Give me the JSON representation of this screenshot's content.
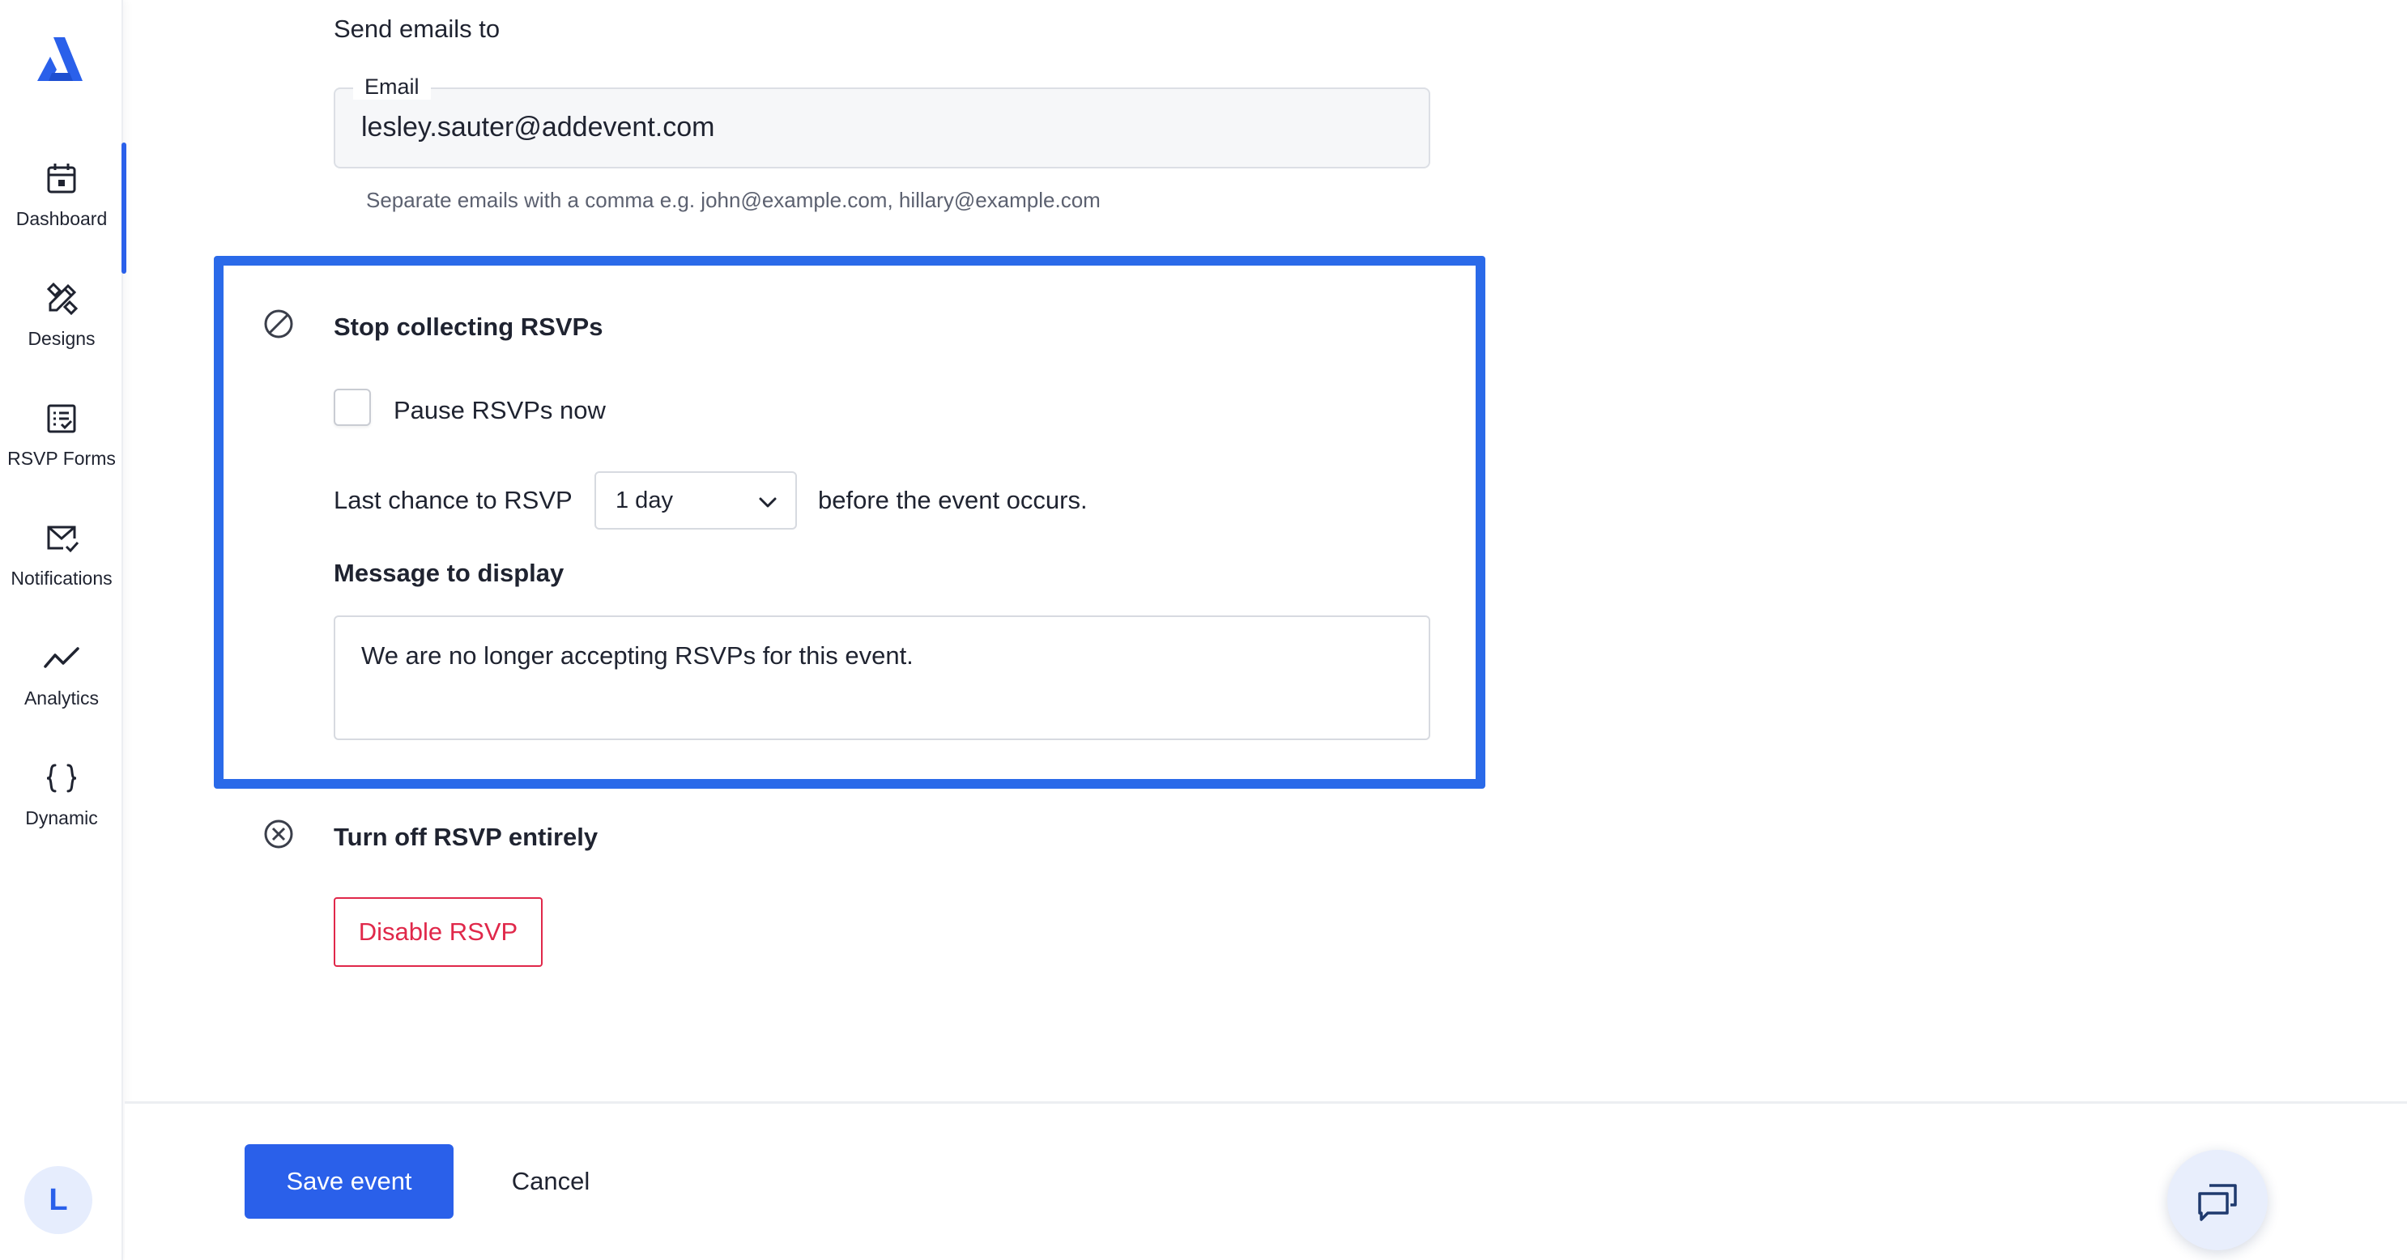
{
  "sidebar": {
    "logo": "addevent-logo",
    "items": [
      {
        "label": "Dashboard",
        "icon": "calendar-icon",
        "active": true
      },
      {
        "label": "Designs",
        "icon": "design-tools-icon",
        "active": false
      },
      {
        "label": "RSVP Forms",
        "icon": "rsvp-form-icon",
        "active": false
      },
      {
        "label": "Notifications",
        "icon": "mail-check-icon",
        "active": false
      },
      {
        "label": "Analytics",
        "icon": "trend-line-icon",
        "active": false
      },
      {
        "label": "Dynamic",
        "icon": "curly-braces-icon",
        "active": false
      }
    ],
    "avatar_initial": "L"
  },
  "emails": {
    "section_title": "Send emails to",
    "field_label": "Email",
    "value": "lesley.sauter@addevent.com",
    "helper": "Separate emails with a comma e.g. john@example.com, hillary@example.com"
  },
  "stop_rsvp": {
    "title": "Stop collecting RSVPs",
    "pause_label": "Pause RSVPs now",
    "pause_checked": false,
    "last_chance_label": "Last chance to RSVP",
    "deadline_value": "1 day",
    "before_text": "before the event occurs.",
    "message_label": "Message to display",
    "message_value": "We are no longer accepting RSVPs for this event."
  },
  "turn_off": {
    "title": "Turn off RSVP entirely",
    "disable_label": "Disable RSVP"
  },
  "footer": {
    "save_label": "Save event",
    "cancel_label": "Cancel"
  },
  "colors": {
    "accent": "#2a60ea",
    "highlight": "#2a6ae9",
    "danger": "#e0284a"
  }
}
